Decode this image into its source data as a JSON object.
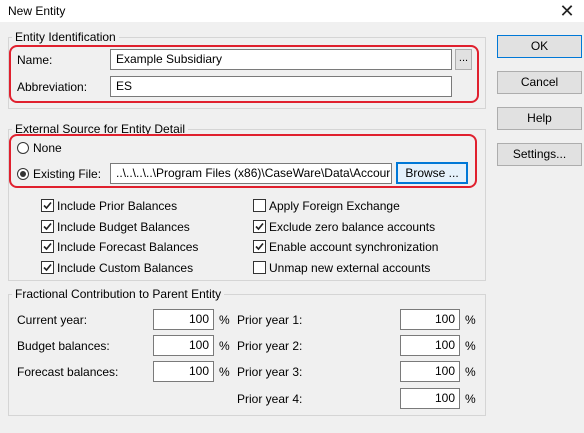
{
  "window": {
    "title": "New Entity",
    "close_label": "✕"
  },
  "buttons": {
    "ok": "OK",
    "cancel": "Cancel",
    "help": "Help",
    "settings": "Settings..."
  },
  "entity_identification": {
    "legend": "Entity Identification",
    "name_label": "Name:",
    "name_value": "Example Subsidiary",
    "ellipsis_label": "...",
    "abbrev_label": "Abbreviation:",
    "abbrev_value": "ES"
  },
  "external_source": {
    "legend": "External Source for Entity Detail",
    "none_label": "None",
    "existing_label": "Existing File:",
    "selected": "existing",
    "path_value": "..\\..\\..\\..\\Program Files (x86)\\CaseWare\\Data\\Accour",
    "browse_label": "Browse ...",
    "checkboxes": [
      {
        "label": "Include Prior Balances",
        "checked": true
      },
      {
        "label": "Include Budget Balances",
        "checked": true
      },
      {
        "label": "Include Forecast Balances",
        "checked": true
      },
      {
        "label": "Include Custom Balances",
        "checked": true
      },
      {
        "label": "Apply Foreign Exchange",
        "checked": false
      },
      {
        "label": "Exclude zero balance accounts",
        "checked": true
      },
      {
        "label": "Enable account synchronization",
        "checked": true
      },
      {
        "label": "Unmap new external accounts",
        "checked": false
      }
    ]
  },
  "fractional": {
    "legend": "Fractional Contribution to Parent Entity",
    "percent_sign": "%",
    "left": [
      {
        "label": "Current year:",
        "value": "100"
      },
      {
        "label": "Budget balances:",
        "value": "100"
      },
      {
        "label": "Forecast balances:",
        "value": "100"
      }
    ],
    "right": [
      {
        "label": "Prior year 1:",
        "value": "100"
      },
      {
        "label": "Prior year 2:",
        "value": "100"
      },
      {
        "label": "Prior year 3:",
        "value": "100"
      },
      {
        "label": "Prior year 4:",
        "value": "100"
      }
    ]
  },
  "colors": {
    "highlight": "#e0202e",
    "focus": "#0078d7",
    "background": "#f0f0f0"
  }
}
